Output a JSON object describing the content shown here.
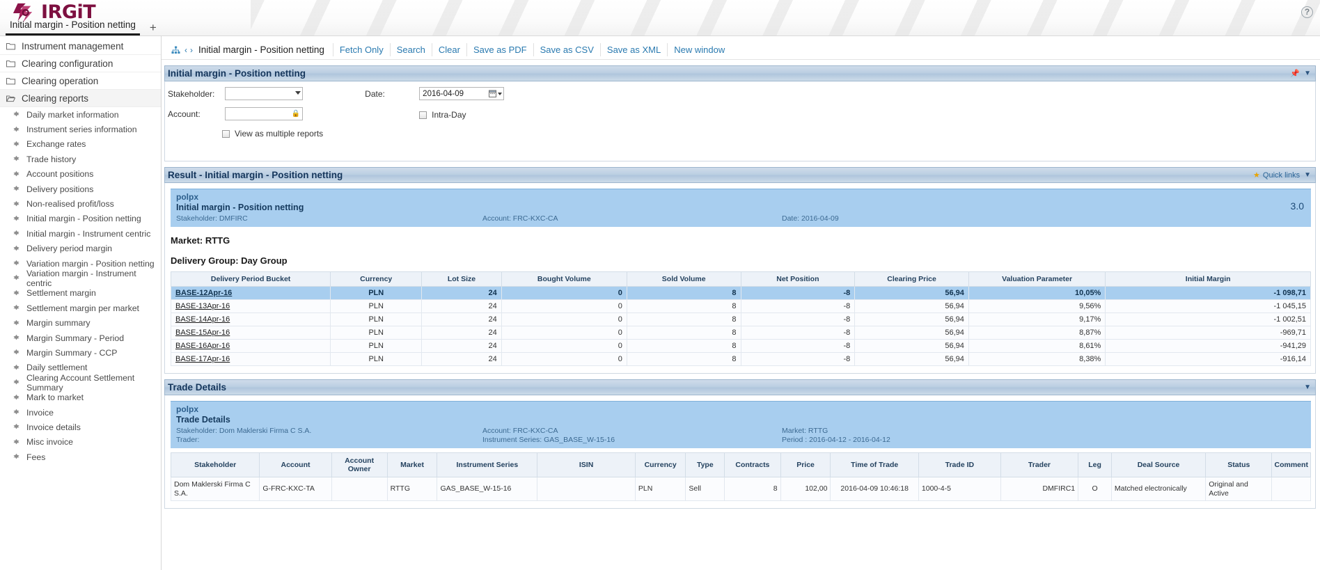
{
  "app": {
    "brand": "IRGiT",
    "help_icon": "help-icon"
  },
  "tabs": [
    {
      "label": "Initial margin - Position netting"
    }
  ],
  "tab_add_label": "+",
  "sidebar": {
    "groups": [
      {
        "label": "Instrument management",
        "icon": "folder-icon",
        "active": false
      },
      {
        "label": "Clearing configuration",
        "icon": "folder-icon",
        "active": false
      },
      {
        "label": "Clearing operation",
        "icon": "folder-icon",
        "active": false
      },
      {
        "label": "Clearing reports",
        "icon": "folder-open-icon",
        "active": true
      }
    ],
    "items": [
      {
        "label": "Daily market information"
      },
      {
        "label": "Instrument series information"
      },
      {
        "label": "Exchange rates"
      },
      {
        "label": "Trade history"
      },
      {
        "label": "Account positions"
      },
      {
        "label": "Delivery positions"
      },
      {
        "label": "Non-realised profit/loss"
      },
      {
        "label": "Initial margin - Position netting"
      },
      {
        "label": "Initial margin - Instrument centric"
      },
      {
        "label": "Delivery period margin"
      },
      {
        "label": "Variation margin - Position netting"
      },
      {
        "label": "Variation margin - Instrument centric"
      },
      {
        "label": "Settlement margin"
      },
      {
        "label": "Settlement margin per market"
      },
      {
        "label": "Margin summary"
      },
      {
        "label": "Margin Summary - Period"
      },
      {
        "label": "Margin Summary - CCP"
      },
      {
        "label": "Daily settlement"
      },
      {
        "label": "Clearing Account Settlement Summary"
      },
      {
        "label": "Mark to market"
      },
      {
        "label": "Invoice"
      },
      {
        "label": "Invoice details"
      },
      {
        "label": "Misc invoice"
      },
      {
        "label": "Fees"
      }
    ]
  },
  "toolbar": {
    "breadcrumb_title": "Initial margin - Position netting",
    "prev_label": "‹",
    "next_label": "›",
    "links": [
      {
        "label": "Fetch Only"
      },
      {
        "label": "Search"
      },
      {
        "label": "Clear"
      },
      {
        "label": "Save as PDF"
      },
      {
        "label": "Save as CSV"
      },
      {
        "label": "Save as XML"
      },
      {
        "label": "New window"
      }
    ]
  },
  "filter_panel": {
    "title": "Initial margin - Position netting",
    "stakeholder_label": "Stakeholder:",
    "stakeholder_value": "",
    "account_label": "Account:",
    "account_value": "",
    "date_label": "Date:",
    "date_value": "2016-04-09",
    "intraday_label": "Intra-Day",
    "intraday_checked": false,
    "multi_reports_label": "View as multiple reports",
    "multi_reports_checked": false
  },
  "result_panel": {
    "title": "Result - Initial margin - Position netting",
    "quick_links_label": "Quick links",
    "banner": {
      "org": "polpx",
      "title": "Initial margin - Position netting",
      "stakeholder": "Stakeholder: DMFIRC",
      "account": "Account: FRC-KXC-CA",
      "date": "Date: 2016-04-09",
      "version": "3.0"
    },
    "market_label": "Market: RTTG",
    "delivery_group_label": "Delivery Group: Day Group",
    "table": {
      "columns": [
        "Delivery Period Bucket",
        "Currency",
        "Lot Size",
        "Bought Volume",
        "Sold Volume",
        "Net Position",
        "Clearing Price",
        "Valuation Parameter",
        "Initial Margin"
      ],
      "rows": [
        {
          "bucket": "BASE-12Apr-16",
          "currency": "PLN",
          "lot_size": "24",
          "bought": "0",
          "sold": "8",
          "net": "-8",
          "price": "56,94",
          "valuation": "10,05%",
          "margin": "-1 098,71",
          "selected": true
        },
        {
          "bucket": "BASE-13Apr-16",
          "currency": "PLN",
          "lot_size": "24",
          "bought": "0",
          "sold": "8",
          "net": "-8",
          "price": "56,94",
          "valuation": "9,56%",
          "margin": "-1 045,15",
          "selected": false
        },
        {
          "bucket": "BASE-14Apr-16",
          "currency": "PLN",
          "lot_size": "24",
          "bought": "0",
          "sold": "8",
          "net": "-8",
          "price": "56,94",
          "valuation": "9,17%",
          "margin": "-1 002,51",
          "selected": false
        },
        {
          "bucket": "BASE-15Apr-16",
          "currency": "PLN",
          "lot_size": "24",
          "bought": "0",
          "sold": "8",
          "net": "-8",
          "price": "56,94",
          "valuation": "8,87%",
          "margin": "-969,71",
          "selected": false
        },
        {
          "bucket": "BASE-16Apr-16",
          "currency": "PLN",
          "lot_size": "24",
          "bought": "0",
          "sold": "8",
          "net": "-8",
          "price": "56,94",
          "valuation": "8,61%",
          "margin": "-941,29",
          "selected": false
        },
        {
          "bucket": "BASE-17Apr-16",
          "currency": "PLN",
          "lot_size": "24",
          "bought": "0",
          "sold": "8",
          "net": "-8",
          "price": "56,94",
          "valuation": "8,38%",
          "margin": "-916,14",
          "selected": false
        }
      ]
    }
  },
  "trade_panel": {
    "title": "Trade Details",
    "banner": {
      "org": "polpx",
      "title": "Trade Details",
      "stakeholder": "Stakeholder: Dom Maklerski Firma C S.A.",
      "trader": "Trader:",
      "account": "Account: FRC-KXC-CA",
      "instrument_series": "Instrument Series: GAS_BASE_W-15-16",
      "market": "Market: RTTG",
      "period": "Period : 2016-04-12 - 2016-04-12"
    },
    "table": {
      "columns": [
        "Stakeholder",
        "Account",
        "Account Owner",
        "Market",
        "Instrument Series",
        "ISIN",
        "Currency",
        "Type",
        "Contracts",
        "Price",
        "Time of Trade",
        "Trade ID",
        "Trader",
        "Leg",
        "Deal Source",
        "Status",
        "Comment"
      ],
      "rows": [
        {
          "stakeholder": "Dom Maklerski Firma C S.A.",
          "account": "G-FRC-KXC-TA",
          "account_owner": "",
          "market": "RTTG",
          "instrument_series": "GAS_BASE_W-15-16",
          "isin": "",
          "currency": "PLN",
          "type": "Sell",
          "contracts": "8",
          "price": "102,00",
          "time_of_trade": "2016-04-09 10:46:18",
          "trade_id": "1000-4-5",
          "trader": "DMFIRC1",
          "leg": "O",
          "deal_source": "Matched electronically",
          "status": "Original and Active",
          "comment": ""
        }
      ]
    }
  },
  "colors": {
    "brand": "#7d1040",
    "link": "#2a7ab0",
    "panel_header": "#aec5dc",
    "selection": "#a8ceef"
  }
}
